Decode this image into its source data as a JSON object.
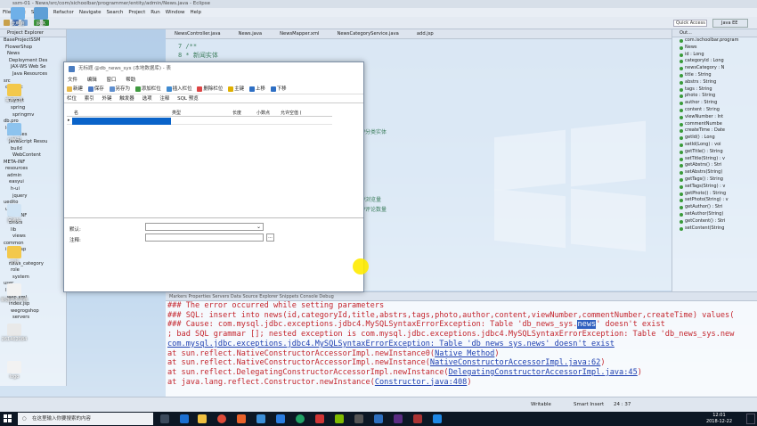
{
  "eclipse": {
    "title": "ssm-01 - News/src/com/sichoolbar/programmer/entity/admin/News.java - Eclipse",
    "menu": [
      "File",
      "Edit",
      "Source",
      "Refactor",
      "Navigate",
      "Search",
      "Project",
      "Run",
      "Window",
      "Help"
    ],
    "quick_access": "Quick Access",
    "perspective": "Java EE",
    "explorer_title": "Project Explorer",
    "tree": [
      "BaseProjectSSM",
      "FlowerShop",
      "News",
      "Deployment Des",
      "JAX-WS Web Se",
      "Java Resources",
      "src",
      "com.sic",
      "config",
      "mybat",
      "spring",
      "springmv",
      "db.pro",
      "log4j",
      "Libraries",
      "JavaScript Resou",
      "build",
      "WebContent",
      "META-INF",
      "resources",
      "admin",
      "easyui",
      "h-ui",
      "jquery",
      "uedito",
      "upload",
      "WEB-INF",
      "errors",
      "lib",
      "views",
      "common",
      "index.jsp",
      "news",
      "news_category",
      "role",
      "system",
      "user",
      "list.jsp",
      "web.xml",
      "index.jsp",
      "wegrogshop",
      "servers"
    ],
    "editor_tabs": [
      "NewsController.java",
      "News.java",
      "NewsMapper.xml",
      "NewsCategoryService.java",
      "add.jsp"
    ],
    "editor_lines": [
      "7  /**",
      "8   *  新闻实体"
    ],
    "editor_comments": [
      "//分类实体",
      "//浏览量",
      "//评论数量"
    ],
    "outline_title": "Out...",
    "outline": [
      "com.ischoolbar.program",
      "News",
      "id : Long",
      "categoryId : Long",
      "newsCategory : N",
      "title : String",
      "abstrs : String",
      "tags : String",
      "photo : String",
      "author : String",
      "content : String",
      "viewNumber : Int",
      "commentNumbe",
      "createTime : Date",
      "getId() : Long",
      "setId(Long) : voi",
      "getTitle() : String",
      "setTitle(String) : v",
      "getAbstrs() : Stri",
      "setAbstrs(String)",
      "getTags() : String",
      "setTags(String) : v",
      "getPhoto() : String",
      "setPhoto(String) : v",
      "getAuthor() : Stri",
      "setAuthor(String)",
      "getContent() : Stri",
      "setContent(String"
    ],
    "console_tabs": "Markers   Properties   Servers   Data Source Explorer   Snippets   Console   Debug",
    "console_lines": [
      "### The error occurred while setting parameters",
      "### SQL: insert into news(id,categoryId,title,abstrs,tags,photo,author,content,viewNumber,commentNumber,createTime) values(",
      "### Cause: com.mysql.jdbc.exceptions.jdbc4.MySQLSyntaxErrorException: Table 'db_news_sys.",
      "; bad SQL grammar []; nested exception is com.mysql.jdbc.exceptions.jdbc4.MySQLSyntaxErrorException: Table 'db_news_sys.new",
      "com.mysql.jdbc.exceptions.jdbc4.MySQLSyntaxErrorException: Table 'db_news_sys.news' doesn't exist",
      "        at sun.reflect.NativeConstructorAccessorImpl.newInstance0(",
      "        at sun.reflect.NativeConstructorAccessorImpl.newInstance(",
      "        at sun.reflect.DelegatingConstructorAccessorImpl.newInstance(",
      "        at java.lang.reflect.Constructor.newInstance("
    ],
    "console_highlight": "news",
    "console_cause_tail": "' doesn't exist",
    "console_links": [
      "Native Method",
      "NativeConstructorAccessorImpl.java:62",
      "DelegatingConstructorAccessorImpl.java:45",
      "Constructor.java:408"
    ],
    "status": {
      "mode": "Writable",
      "insert": "Smart Insert",
      "pos": "24 : 37"
    }
  },
  "desktop_icons": [
    "此电脑",
    "网络",
    "实用工具",
    "小秘书",
    "回收站",
    "文档",
    "新建文本文档",
    "261462084",
    "logo"
  ],
  "dialog": {
    "title": "无标题 @db_news_sys (本地数据库) - 表",
    "menu": [
      "文件",
      "编辑",
      "窗口",
      "帮助"
    ],
    "toolbar": [
      "新建",
      "保存",
      "另存为",
      "添加栏位",
      "插入栏位",
      "删除栏位",
      "主键",
      "上移",
      "下移"
    ],
    "tabs": [
      "栏位",
      "索引",
      "外键",
      "触发器",
      "选项",
      "注释",
      "SQL 预览"
    ],
    "columns": [
      "名",
      "类型",
      "长度",
      "小数点",
      "允许空值 ("
    ],
    "default_label": "默认:",
    "comment_label": "注释:",
    "ellipsis": "..."
  },
  "taskbar": {
    "search_placeholder": "在这里输入你要搜索的内容",
    "time": "12:01",
    "date": "2018-12-22"
  }
}
